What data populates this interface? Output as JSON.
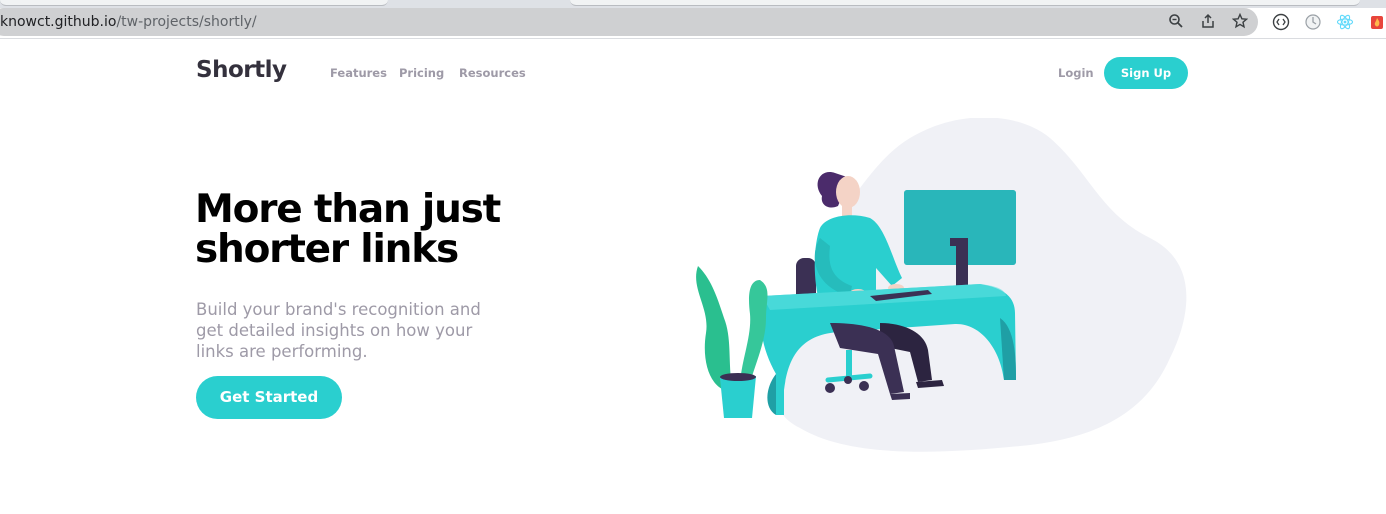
{
  "browser": {
    "url_host": "knowct.github.io",
    "url_path": "/tw-projects/shortly/",
    "icons": [
      "zoom-icon",
      "share-icon",
      "bookmark-star-icon",
      "extension-code-icon",
      "extension-clock-icon",
      "react-devtools-icon",
      "extension-fire-icon"
    ]
  },
  "site": {
    "logo": "Shortly",
    "nav": {
      "features": "Features",
      "pricing": "Pricing",
      "resources": "Resources"
    },
    "login": "Login",
    "signup": "Sign Up"
  },
  "hero": {
    "headline": "More than just shorter links",
    "subtext": "Build your brand's recognition and get detailed insights on how your links are performing.",
    "cta": "Get Started",
    "illustration": "person-working-at-desk-illustration"
  },
  "colors": {
    "cyan": "#2acfcf",
    "dark_violet": "#3b3054",
    "grayish_violet": "#9e9aa7",
    "blob": "#f0f1f6"
  }
}
